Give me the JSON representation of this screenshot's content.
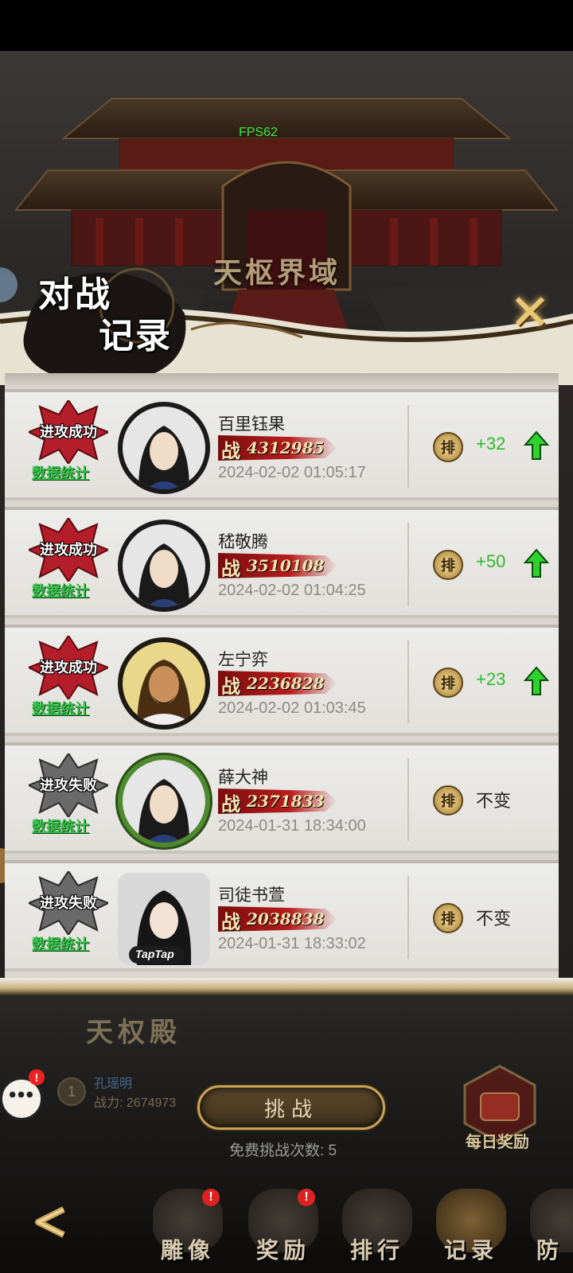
{
  "overlay": {
    "fps": "FPS62"
  },
  "scene": {
    "arena_name": "天枢界域"
  },
  "panel": {
    "title_line1": "对战",
    "title_line2": "记录",
    "close_icon": "close-x-icon"
  },
  "records": [
    {
      "result": "进攻成功",
      "result_type": "win",
      "stats_label": "数据统计",
      "name": "百里钰果",
      "power_icon": "战",
      "power": "4312985",
      "time": "2024-02-02 01:05:17",
      "rank_icon": "排",
      "rank_change": "+32",
      "arrow": "up"
    },
    {
      "result": "进攻成功",
      "result_type": "win",
      "stats_label": "数据统计",
      "name": "嵇敬腾",
      "power_icon": "战",
      "power": "3510108",
      "time": "2024-02-02 01:04:25",
      "rank_icon": "排",
      "rank_change": "+50",
      "arrow": "up"
    },
    {
      "result": "进攻成功",
      "result_type": "win",
      "stats_label": "数据统计",
      "name": "左宁弈",
      "power_icon": "战",
      "power": "2236828",
      "time": "2024-02-02 01:03:45",
      "rank_icon": "排",
      "rank_change": "+23",
      "arrow": "up"
    },
    {
      "result": "进攻失败",
      "result_type": "lose",
      "stats_label": "数据统计",
      "name": "薛大神",
      "power_icon": "战",
      "power": "2371833",
      "time": "2024-01-31 18:34:00",
      "rank_icon": "排",
      "rank_change": "不变",
      "arrow": "none"
    },
    {
      "result": "进攻失败",
      "result_type": "lose",
      "stats_label": "数据统计",
      "name": "司徒书萱",
      "power_icon": "战",
      "power": "2038838",
      "time": "2024-01-31 18:33:02",
      "rank_icon": "排",
      "rank_change": "不变",
      "arrow": "none",
      "avatar_label": "TapTap"
    }
  ],
  "bottom": {
    "hall_name": "天权殿",
    "holder_rank": "1",
    "holder_name": "孔瑶明",
    "holder_power": "战力: 2674973",
    "challenge_label": "挑战",
    "free_challenges": "免费挑战次数: 5",
    "daily_reward_label": "每日奖励",
    "chat_alert": "!"
  },
  "nav": {
    "items": [
      {
        "label": "雕像",
        "alert": "!"
      },
      {
        "label": "奖励",
        "alert": "!"
      },
      {
        "label": "排行",
        "alert": ""
      },
      {
        "label": "记录",
        "alert": ""
      },
      {
        "label": "防"
      }
    ]
  },
  "colors": {
    "win_red": "#b41e2a",
    "lose_gray": "#6a6a6a",
    "rank_up_green": "#2bbb2b",
    "stats_green": "#35c44a",
    "gold": "#c9a55a"
  }
}
